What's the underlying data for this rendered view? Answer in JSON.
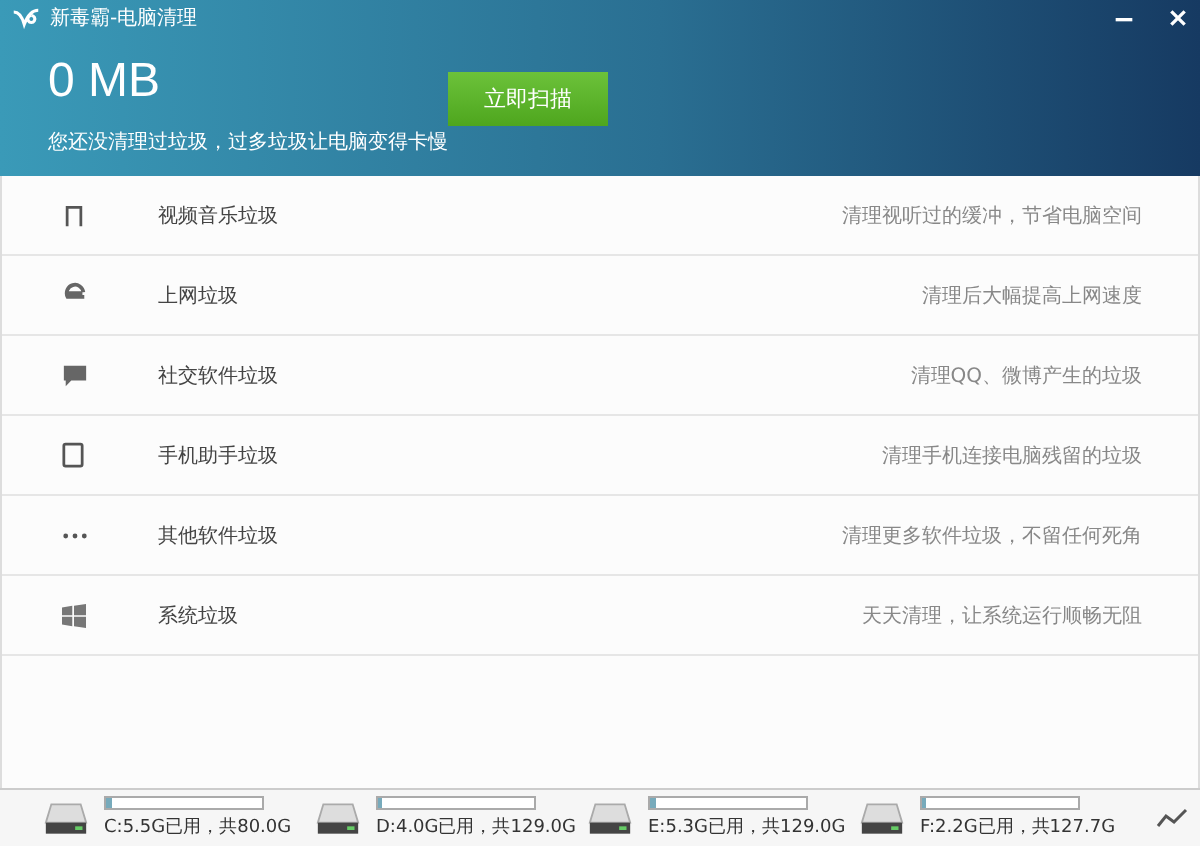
{
  "window": {
    "title": "新毒霸-电脑清理"
  },
  "summary": {
    "size": "0 MB",
    "message": "您还没清理过垃圾，过多垃圾让电脑变得卡慢",
    "scan_button": "立即扫描"
  },
  "categories": [
    {
      "kind": "music",
      "name": "视频音乐垃圾",
      "description": "清理视听过的缓冲，节省电脑空间"
    },
    {
      "kind": "web",
      "name": "上网垃圾",
      "description": "清理后大幅提高上网速度"
    },
    {
      "kind": "chat",
      "name": "社交软件垃圾",
      "description": "清理QQ、微博产生的垃圾"
    },
    {
      "kind": "phone",
      "name": "手机助手垃圾",
      "description": "清理手机连接电脑残留的垃圾"
    },
    {
      "kind": "more",
      "name": "其他软件垃圾",
      "description": "清理更多软件垃圾，不留任何死角"
    },
    {
      "kind": "windows",
      "name": "系统垃圾",
      "description": "天天清理，让系统运行顺畅无阻"
    }
  ],
  "drives": [
    {
      "label": "C:5.5G已用，共80.0G",
      "level": 0.04
    },
    {
      "label": "D:4.0G已用，共129.0G",
      "level": 0.03
    },
    {
      "label": "E:5.3G已用，共129.0G",
      "level": 0.04
    },
    {
      "label": "F:2.2G已用，共127.7G",
      "level": 0.02
    }
  ]
}
